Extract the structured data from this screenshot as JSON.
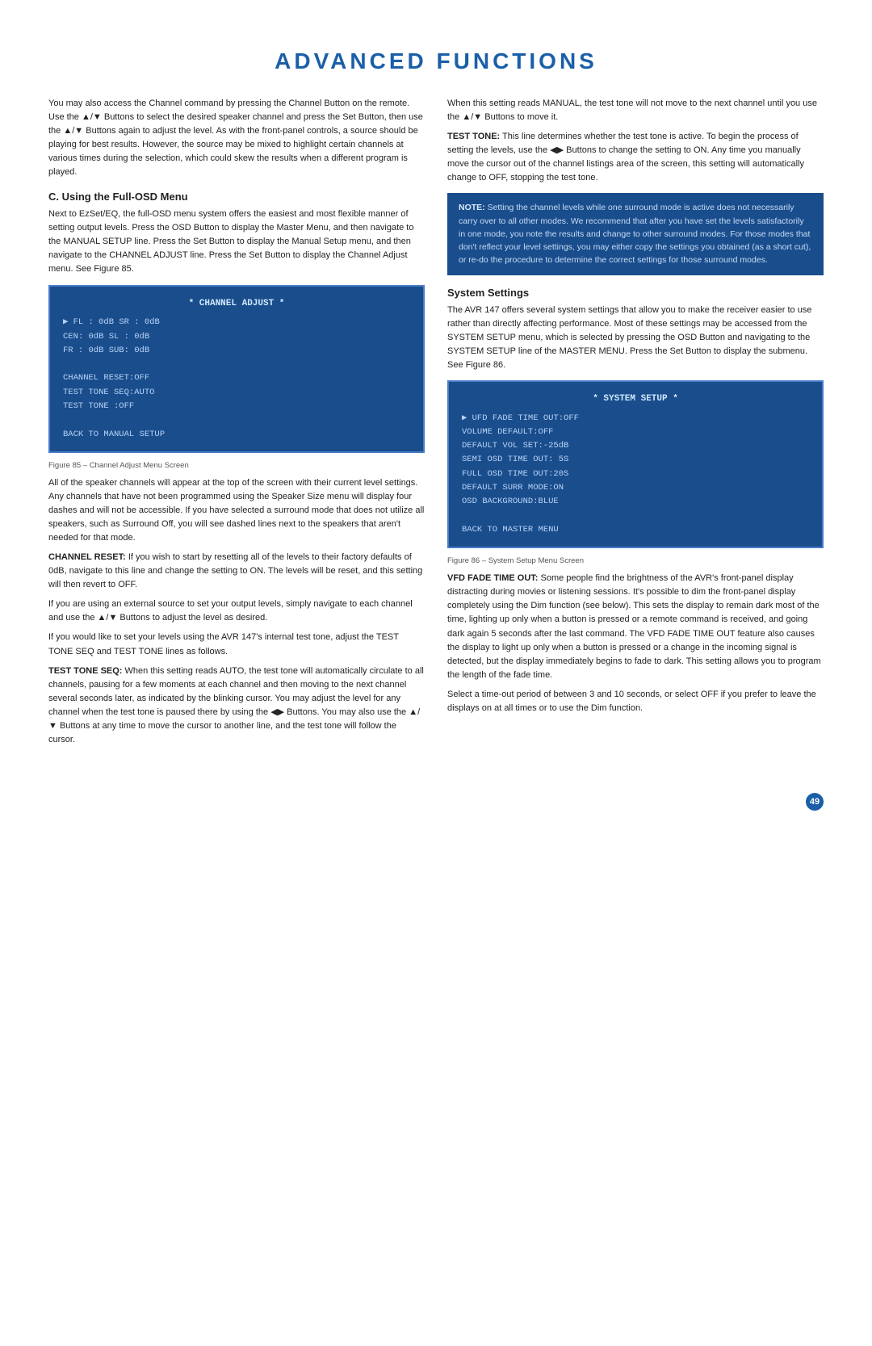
{
  "page": {
    "title": "ADVANCED FUNCTIONS",
    "page_number": "49"
  },
  "left_column": {
    "intro_text": "You may also access the Channel command by pressing the Channel Button on the remote. Use the ▲/▼ Buttons to select the desired speaker channel and press the Set Button, then use the ▲/▼ Buttons again to adjust the level. As with the front-panel controls, a source should be playing for best results. However, the source may be mixed to highlight certain channels at various times during the selection, which could skew the results when a different program is played.",
    "section_c": {
      "heading": "C. Using the Full-OSD Menu",
      "text1": "Next to EzSet/EQ, the full-OSD menu system offers the easiest and most flexible manner of setting output levels. Press the OSD Button to display the Master Menu, and then navigate to the MANUAL SETUP line. Press the Set Button to display the Manual Setup menu, and then navigate to the CHANNEL ADJUST line. Press the Set Button to display the Channel Adjust menu. See Figure 85.",
      "screen1": {
        "title": "* CHANNEL ADJUST *",
        "line1": "▶  FL :  0dB    SR :   0dB",
        "line2": "   CEN: 0dB    SL :   0dB",
        "line3": "   FR :  0dB   SUB:  0dB",
        "line4": "",
        "line5": "CHANNEL RESET:OFF",
        "line6": "TEST TONE SEQ:AUTO",
        "line7": "TEST TONE    :OFF",
        "line8": "",
        "line9": "BACK TO MANUAL SETUP"
      },
      "figure1_caption": "Figure 85 – Channel Adjust Menu Screen",
      "text2": "All of the speaker channels will appear at the top of the screen with their current level settings. Any channels that have not been programmed using the Speaker Size menu will display four dashes and will not be accessible. If you have selected a surround mode that does not utilize all speakers, such as Surround Off, you will see dashed lines next to the speakers that aren't needed for that mode.",
      "channel_reset_heading": "CHANNEL RESET:",
      "channel_reset_text": " If you wish to start by resetting all of the levels to their factory defaults of 0dB, navigate to this line and change the setting to ON. The levels will be reset, and this setting will then revert to OFF.",
      "text3": "If you are using an external source to set your output levels, simply navigate to each channel and use the ▲/▼ Buttons to adjust the level as desired.",
      "text4": "If you would like to set your levels using the AVR 147's internal test tone, adjust the TEST TONE SEQ  and TEST TONE lines as follows.",
      "test_tone_seq_heading": "TEST TONE SEQ:",
      "test_tone_seq_text": " When this setting reads AUTO, the test tone will automatically circulate to all channels, pausing for a few moments at each channel and then moving to the next channel several seconds later, as indicated by the blinking cursor. You may adjust the level for any channel when the test tone is paused there by using the ◀▶ Buttons. You may also use the ▲/▼ Buttons at any time to move the cursor to another line, and the test tone will follow the cursor."
    }
  },
  "right_column": {
    "manual_text": "When this setting reads MANUAL, the test tone will not move to the next channel until you use the ▲/▼ Buttons to move it.",
    "test_tone_heading": "TEST TONE:",
    "test_tone_text": " This line determines whether the test tone is active. To begin the process of setting the levels, use the ◀▶ Buttons to change the setting to ON. Any time you manually move the cursor out of the channel listings area of the screen, this setting will automatically change to OFF, stopping the test tone.",
    "note_box": {
      "title": "NOTE:",
      "text": " Setting the channel levels while one surround mode is active does not necessarily carry over to all other modes. We recommend that after you have set the levels satisfactorily in one mode, you note the results and change to other surround modes. For those modes that don't reflect your level settings, you may either copy the settings you obtained (as a short cut), or re-do the procedure to determine the correct settings for those surround modes."
    },
    "system_settings": {
      "heading": "System Settings",
      "text1": "The AVR 147 offers several system settings that allow you to make the receiver easier to use rather than directly affecting performance. Most of these settings may be accessed from the SYSTEM SETUP menu, which is selected by pressing the OSD Button and navigating to the SYSTEM SETUP line of the MASTER MENU. Press the Set Button to display the submenu. See Figure 86.",
      "screen2": {
        "title": "* SYSTEM SETUP *",
        "line1": "▶ UFD FADE TIME OUT:OFF",
        "line2": "   VOLUME DEFAULT:OFF",
        "line3": "   DEFAULT VOL SET:-25dB",
        "line4": "   SEMI OSD TIME OUT: 5S",
        "line5": "   FULL OSD TIME OUT:20S",
        "line6": "   DEFAULT SURR MODE:ON",
        "line7": "   OSD BACKGROUND:BLUE",
        "line8": "",
        "line9": "   BACK TO MASTER MENU"
      },
      "figure2_caption": "Figure 86 – System Setup Menu Screen",
      "vfd_heading": "VFD FADE TIME OUT:",
      "vfd_text": " Some people find the brightness of the AVR's front-panel display distracting during movies or listening sessions. It's possible to dim the front-panel display completely using the Dim function (see below). This sets the display to remain dark most of the time, lighting up only when a button is pressed or a remote command is received, and going dark again 5 seconds after the last command. The VFD FADE TIME OUT feature also causes the display to light up only when a button is pressed or a change in the incoming signal is detected, but the display immediately begins to fade to dark. This setting allows you to program the length of the fade time.",
      "text2": "Select a time-out period of between 3 and 10 seconds, or select OFF if you prefer to leave the displays on at all times or to use the Dim function."
    }
  }
}
